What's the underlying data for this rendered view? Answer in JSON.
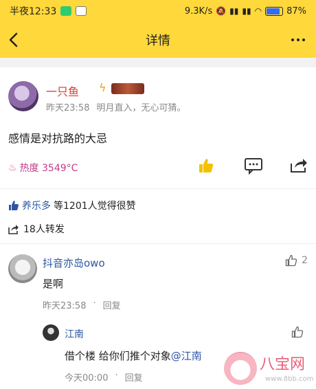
{
  "status_bar": {
    "time": "半夜12:33",
    "network_speed": "9.3K/s",
    "battery": "87%",
    "battery_level": 0.87
  },
  "header": {
    "title": "详情"
  },
  "post": {
    "author": "一只鱼",
    "time": "昨天23:58",
    "signature": "明月直入，无心可猜。",
    "text": "感情是对抗路的大忌",
    "heat_label": "热度 3549°C",
    "likes_prefix": "养乐多",
    "likes_suffix": "等1201人觉得很赞",
    "shares": "18人转发"
  },
  "comments": [
    {
      "author": "抖音亦岛owo",
      "text": "是啊",
      "time": "昨天23:58",
      "reply_label": "回复",
      "like_count": "2"
    }
  ],
  "reply": {
    "author": "江南",
    "text_prefix": "借个楼 给你们推个对象",
    "mention": "@江南",
    "time": "今天00:00",
    "reply_label": "回复"
  },
  "watermark": {
    "title": "八宝网",
    "url": "www.8bb.com"
  },
  "colors": {
    "header_bg": "#FFD83B",
    "author_red": "#d43a2f",
    "link_blue": "#2c56a3",
    "like_yellow": "#f2c200"
  }
}
